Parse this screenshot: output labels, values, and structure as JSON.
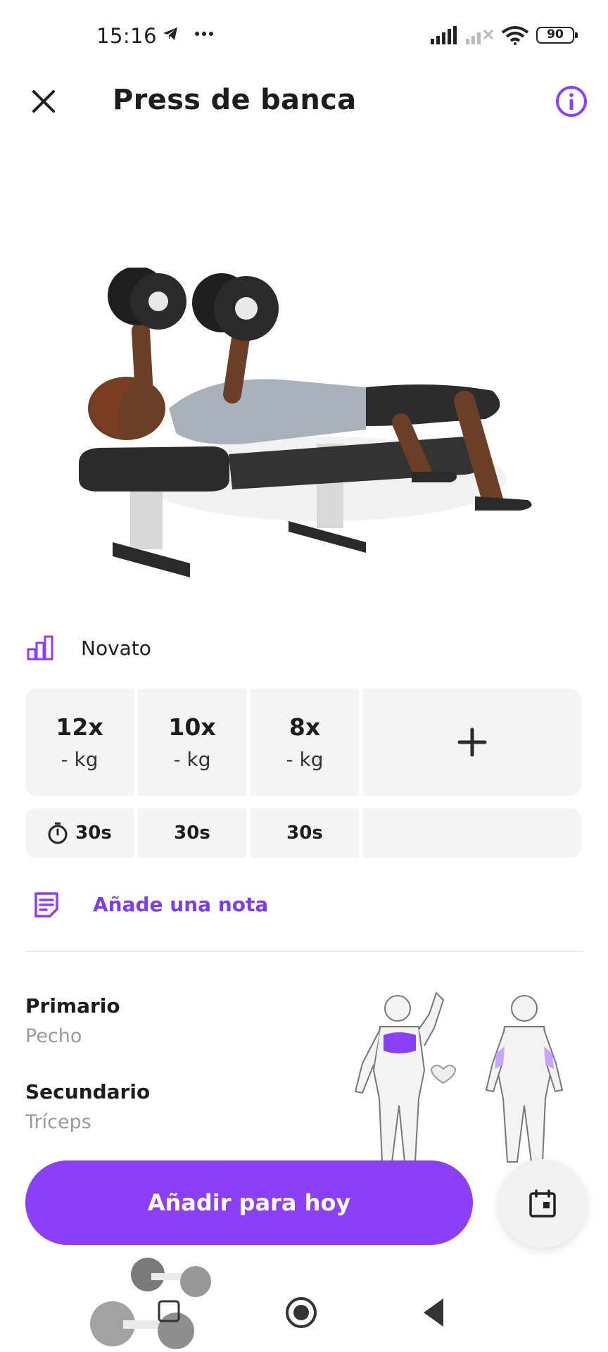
{
  "status_bar": {
    "time": "15:16",
    "battery": "90",
    "icons": [
      "telegram-icon",
      "more-dots-icon",
      "signal-icon",
      "signal-off-icon",
      "wifi-icon",
      "battery-icon"
    ]
  },
  "header": {
    "title": "Press de banca",
    "close_icon": "close-icon",
    "info_icon": "info-icon"
  },
  "exercise": {
    "level_icon": "level-bars-icon",
    "level": "Novato",
    "sets": [
      {
        "reps": "12x",
        "weight": "- kg"
      },
      {
        "reps": "10x",
        "weight": "- kg"
      },
      {
        "reps": "8x",
        "weight": "- kg"
      }
    ],
    "add_set_icon": "plus-icon",
    "rest": [
      {
        "value": "30s"
      },
      {
        "value": "30s"
      },
      {
        "value": "30s"
      }
    ],
    "timer_icon": "stopwatch-icon",
    "note_label": "Añade una nota",
    "note_icon": "note-icon"
  },
  "muscles": {
    "primary_label": "Primario",
    "primary_value": "Pecho",
    "secondary_label": "Secundario",
    "secondary_value": "Tríceps"
  },
  "actions": {
    "add_today": "Añadir para hoy",
    "calendar_icon": "calendar-icon"
  },
  "colors": {
    "accent": "#8b3ff7",
    "accent_text": "#7b3fe4",
    "cell_bg": "#f4f4f5"
  }
}
